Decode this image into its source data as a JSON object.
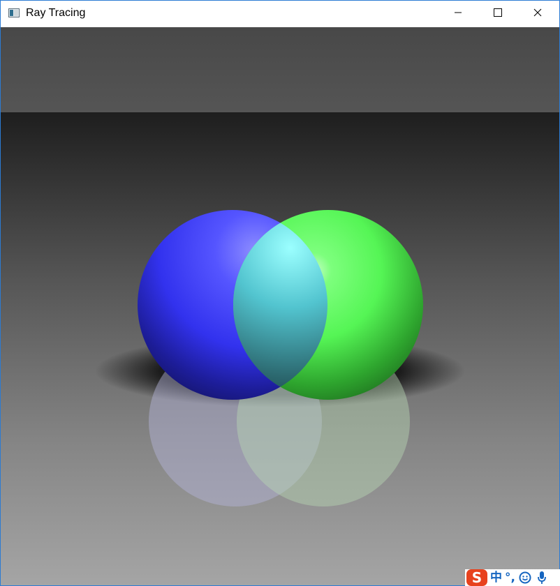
{
  "window": {
    "title": "Ray Tracing",
    "icon": "app-window-icon",
    "controls": {
      "minimize_icon": "minimize-icon",
      "maximize_icon": "maximize-icon",
      "close_icon": "close-icon"
    }
  },
  "scene": {
    "background_top": "#4f4f4f",
    "floor_far": "#1f1f1f",
    "floor_near": "#a3a3a3",
    "spheres": [
      {
        "color": "#3a3aff"
      },
      {
        "color": "#4aff4a"
      }
    ]
  },
  "taskbar_ime": {
    "logo": "S",
    "mode": "中",
    "punct": "°,",
    "emoji_icon": "smiley-icon",
    "mic_icon": "microphone-icon",
    "accent": "#e8421e",
    "text_color": "#1565c0"
  }
}
